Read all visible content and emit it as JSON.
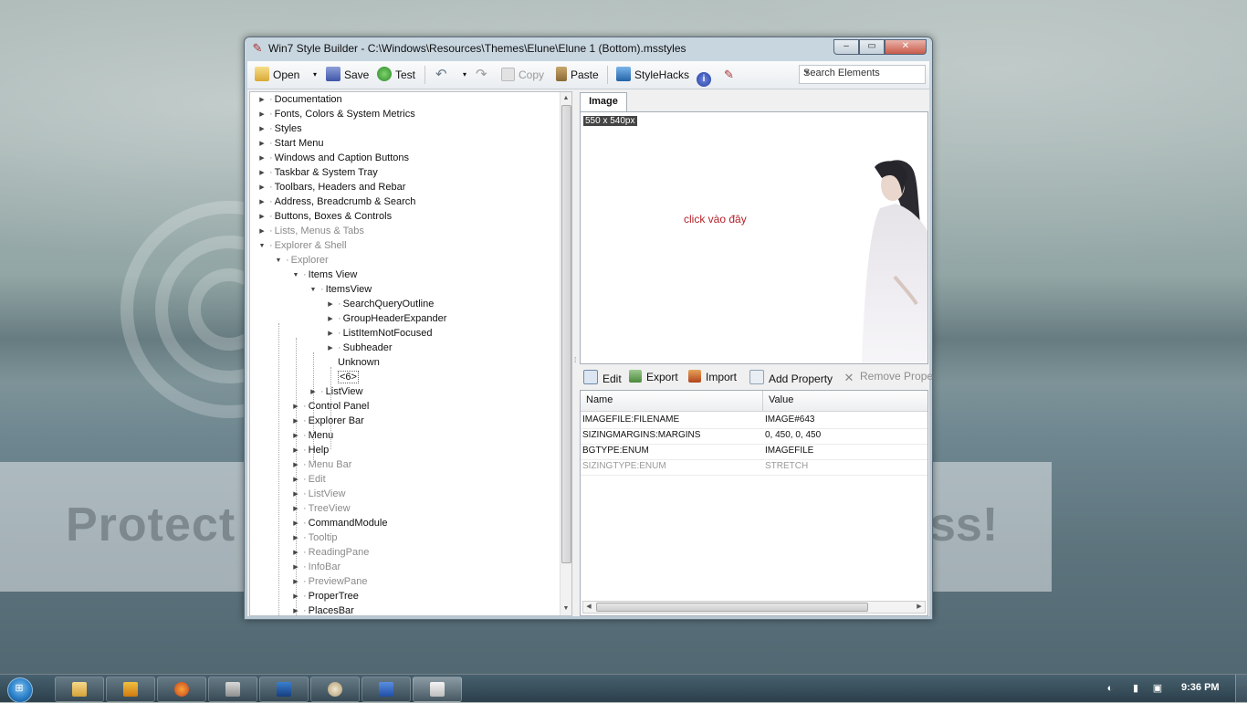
{
  "window": {
    "title": "Win7 Style Builder - C:\\Windows\\Resources\\Themes\\Elune\\Elune 1 (Bottom).msstyles",
    "controls": {
      "minimize": "–",
      "maximize": "▭",
      "close": "✕"
    }
  },
  "toolbar": {
    "open": "Open",
    "save": "Save",
    "test": "Test",
    "copy": "Copy",
    "paste": "Paste",
    "stylehacks": "StyleHacks",
    "search_placeholder": "Search Elements"
  },
  "tree": {
    "items": [
      {
        "label": "Documentation"
      },
      {
        "label": "Fonts, Colors & System Metrics"
      },
      {
        "label": "Styles"
      },
      {
        "label": "Start Menu"
      },
      {
        "label": "Windows and Caption Buttons"
      },
      {
        "label": "Taskbar & System Tray"
      },
      {
        "label": "Toolbars, Headers and Rebar"
      },
      {
        "label": "Address, Breadcrumb & Search"
      },
      {
        "label": "Buttons, Boxes & Controls"
      },
      {
        "label": "Lists, Menus & Tabs"
      },
      {
        "label": "Explorer & Shell"
      },
      {
        "label": "Explorer"
      },
      {
        "label": "Items View"
      },
      {
        "label": "ItemsView"
      },
      {
        "label": "SearchQueryOutline"
      },
      {
        "label": "GroupHeaderExpander"
      },
      {
        "label": "ListItemNotFocused"
      },
      {
        "label": "Subheader"
      },
      {
        "label": "Unknown"
      },
      {
        "label": "<6>"
      },
      {
        "label": "ListView"
      },
      {
        "label": "Control Panel"
      },
      {
        "label": "Explorer Bar"
      },
      {
        "label": "Menu"
      },
      {
        "label": "Help"
      },
      {
        "label": "Menu Bar"
      },
      {
        "label": "Edit"
      },
      {
        "label": "ListView"
      },
      {
        "label": "TreeView"
      },
      {
        "label": "CommandModule"
      },
      {
        "label": "Tooltip"
      },
      {
        "label": "ReadingPane"
      },
      {
        "label": "InfoBar"
      },
      {
        "label": "PreviewPane"
      },
      {
        "label": "ProperTree"
      },
      {
        "label": "PlacesBar"
      }
    ]
  },
  "image_tab": {
    "tab_label": "Image",
    "dimensions": "550 x 540px",
    "overlay_text": "click vào đây"
  },
  "actions": {
    "edit": "Edit",
    "export": "Export",
    "import": "Import",
    "add_property": "Add Property",
    "remove_property": "Remove Prope"
  },
  "properties": {
    "columns": [
      "Name",
      "Value"
    ],
    "rows": [
      {
        "name": "IMAGEFILE:FILENAME",
        "value": "IMAGE#643"
      },
      {
        "name": "SIZINGMARGINS:MARGINS",
        "value": "0, 450, 0, 450"
      },
      {
        "name": "BGTYPE:ENUM",
        "value": "IMAGEFILE"
      },
      {
        "name": "SIZINGTYPE:ENUM",
        "value": "STRETCH"
      }
    ]
  },
  "watermark": {
    "left": "Protect",
    "right": "ss!"
  },
  "taskbar": {
    "clock": "9:36 PM",
    "apps": [
      "explorer-icon",
      "media-player-icon",
      "firefox-icon",
      "tools-icon",
      "photoshop-icon",
      "paint-icon",
      "word-icon",
      "style-builder-icon"
    ]
  },
  "colors": {
    "accent_red": "#b3222b",
    "window_frame": "#b8c8d2",
    "taskbar": "#2f4a58"
  }
}
